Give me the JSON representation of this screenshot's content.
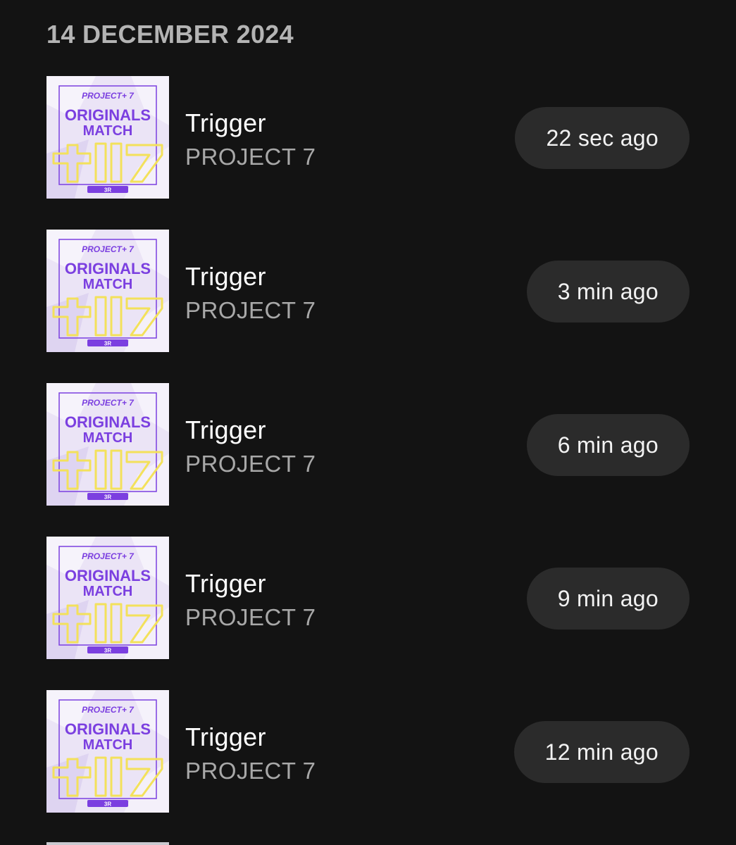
{
  "section": {
    "date": "14 DECEMBER 2024"
  },
  "artwork": {
    "brand": "PROJECT 7",
    "line1": "ORIGINALS",
    "line2": "MATCH",
    "badge": "3R",
    "colors": {
      "background": "#ebe4f6",
      "accent": "#7b3fe0",
      "highlight": "#f3e15b"
    }
  },
  "items": [
    {
      "title": "Trigger",
      "artist": "PROJECT 7",
      "time": "22 sec ago"
    },
    {
      "title": "Trigger",
      "artist": "PROJECT 7",
      "time": "3 min ago"
    },
    {
      "title": "Trigger",
      "artist": "PROJECT 7",
      "time": "6 min ago"
    },
    {
      "title": "Trigger",
      "artist": "PROJECT 7",
      "time": "9 min ago"
    },
    {
      "title": "Trigger",
      "artist": "PROJECT 7",
      "time": "12 min ago"
    }
  ]
}
